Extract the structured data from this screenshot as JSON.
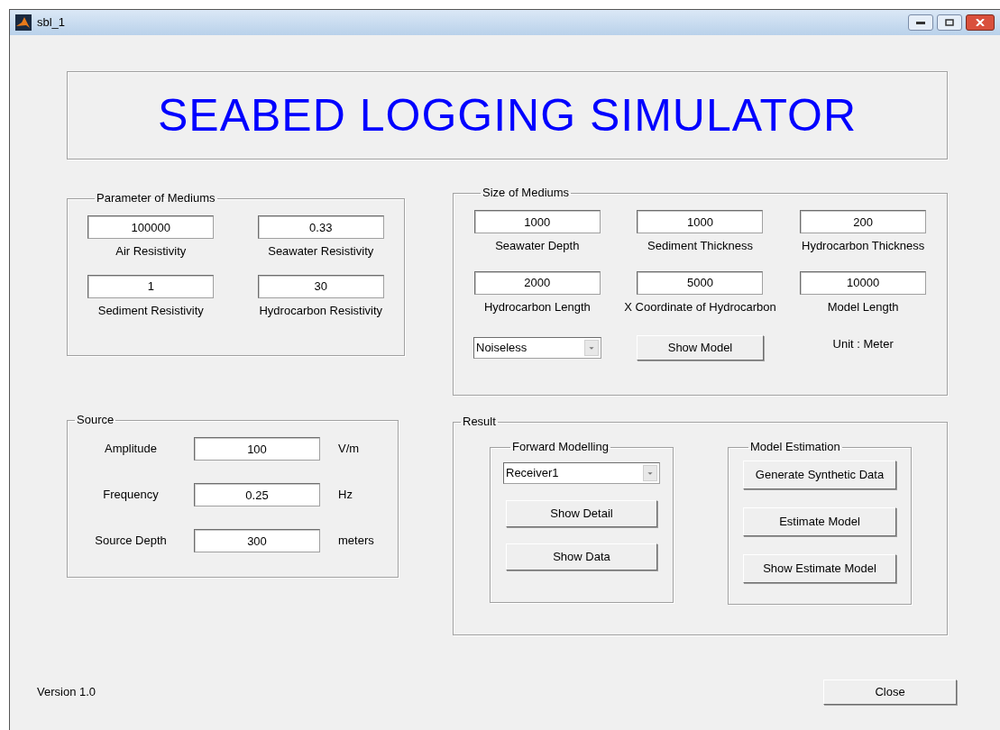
{
  "window": {
    "title": "sbl_1"
  },
  "banner": {
    "title": "SEABED LOGGING SIMULATOR"
  },
  "parameter_of_mediums": {
    "title": "Parameter of Mediums",
    "fields": [
      {
        "label": "Air Resistivity",
        "value": "100000"
      },
      {
        "label": "Seawater Resistivity",
        "value": "0.33"
      },
      {
        "label": "Sediment Resistivity",
        "value": "1"
      },
      {
        "label": "Hydrocarbon Resistivity",
        "value": "30"
      }
    ]
  },
  "size_of_mediums": {
    "title": "Size of Mediums",
    "fields": [
      {
        "label": "Seawater Depth",
        "value": "1000"
      },
      {
        "label": "Sediment Thickness",
        "value": "1000"
      },
      {
        "label": "Hydrocarbon Thickness",
        "value": "200"
      },
      {
        "label": "Hydrocarbon Length",
        "value": "2000"
      },
      {
        "label": "X Coordinate of Hydrocarbon",
        "value": "5000"
      },
      {
        "label": "Model Length",
        "value": "10000"
      }
    ],
    "noise_dropdown": {
      "value": "Noiseless"
    },
    "show_model_button": "Show Model",
    "unit_label": "Unit : Meter"
  },
  "source": {
    "title": "Source",
    "rows": [
      {
        "label": "Amplitude",
        "value": "100",
        "unit": "V/m"
      },
      {
        "label": "Frequency",
        "value": "0.25",
        "unit": "Hz"
      },
      {
        "label": "Source Depth",
        "value": "300",
        "unit": "meters"
      }
    ]
  },
  "result": {
    "title": "Result",
    "forward_modelling": {
      "title": "Forward Modelling",
      "dropdown": {
        "value": "Receiver1"
      },
      "buttons": [
        "Show Detail",
        "Show Data"
      ]
    },
    "model_estimation": {
      "title": "Model Estimation",
      "buttons": [
        "Generate Synthetic Data",
        "Estimate Model",
        "Show Estimate Model"
      ]
    }
  },
  "footer": {
    "version": "Version 1.0",
    "close_button": "Close"
  }
}
